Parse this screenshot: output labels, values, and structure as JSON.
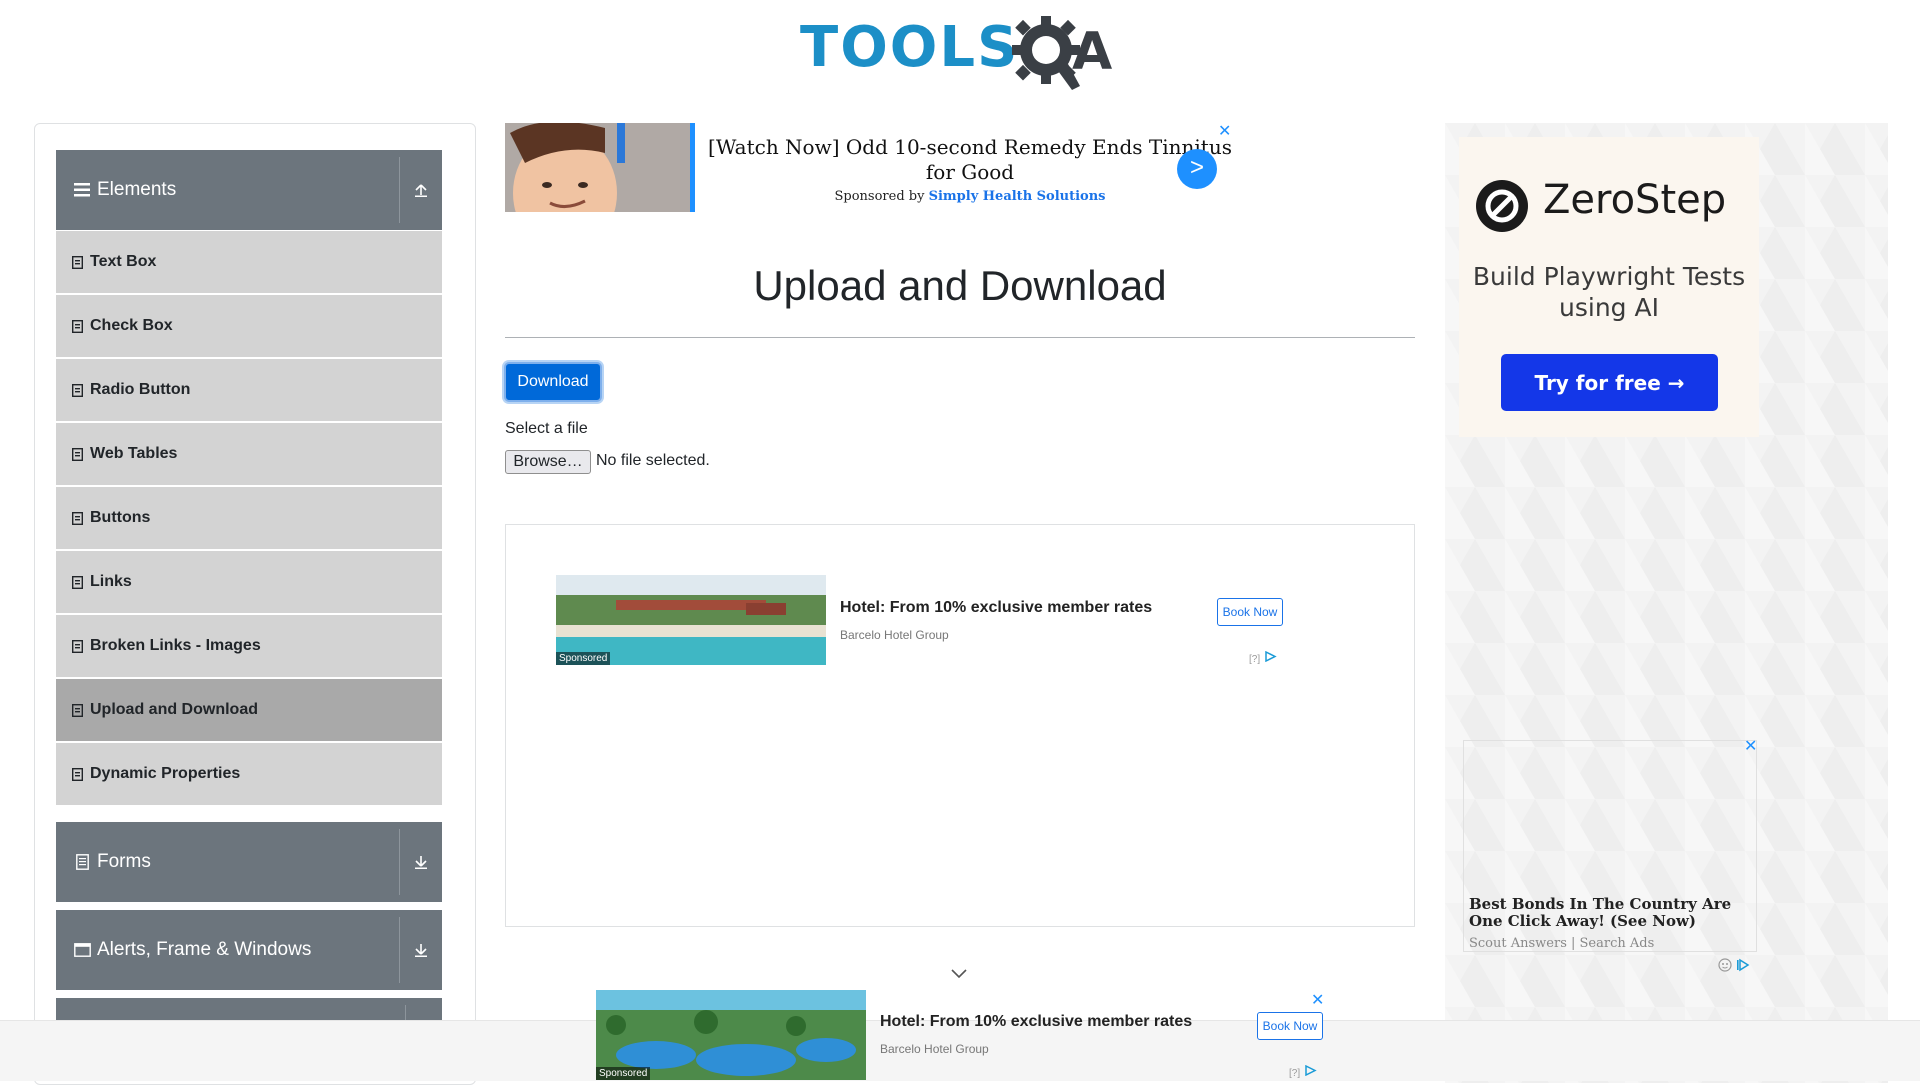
{
  "header": {
    "logo_tools": "TOOLS",
    "logo_a": "A"
  },
  "sidebar": {
    "groups": [
      {
        "label": "Elements",
        "icon": "hamburger-icon",
        "toggle": "collapse-up-icon"
      },
      {
        "label": "Forms",
        "icon": "form-icon",
        "toggle": "expand-down-icon"
      },
      {
        "label": "Alerts, Frame & Windows",
        "icon": "window-icon",
        "toggle": "expand-down-icon"
      }
    ],
    "items": [
      "Text Box",
      "Check Box",
      "Radio Button",
      "Web Tables",
      "Buttons",
      "Links",
      "Broken Links - Images",
      "Upload and Download",
      "Dynamic Properties"
    ],
    "active_item": "Upload and Download"
  },
  "top_ad": {
    "title": "[Watch Now] Odd 10-second Remedy Ends Tinnitus for Good",
    "sponsored_by": "Sponsored by",
    "sponsor": "Simply Health Solutions",
    "go_label": ">",
    "close": "✕"
  },
  "main": {
    "title": "Upload and Download",
    "download_label": "Download",
    "select_label": "Select a file",
    "browse_label": "Browse…",
    "no_file": "No file selected."
  },
  "hotel_ad": {
    "title": "Hotel: From 10% exclusive member rates",
    "sub": "Barcelo Hotel Group",
    "book": "Book Now",
    "sponsored": "Sponsored",
    "adinfo": "[?]"
  },
  "right_ad": {
    "brand": "ZeroStep",
    "tagline": "Build Playwright Tests using AI",
    "cta": "Try for free →"
  },
  "bonds_ad": {
    "title": "Best Bonds In The Country Are One Click Away! (See Now)",
    "sub": "Scout Answers | Search Ads",
    "close": "✕"
  },
  "colors": {
    "accent": "#0069d9",
    "menu_header": "#6c757d",
    "menu_item": "#d3d3d3",
    "menu_active": "#a9a9a9",
    "brand_blue": "#1c8fc7"
  }
}
